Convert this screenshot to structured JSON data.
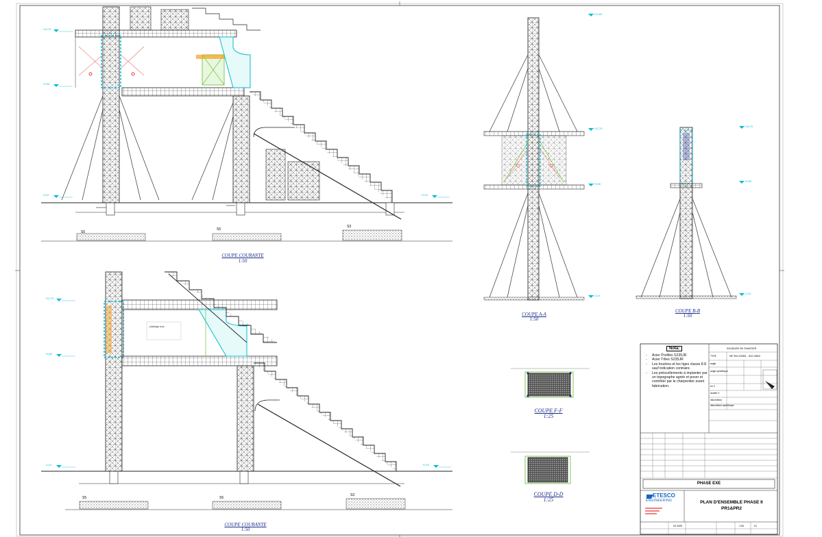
{
  "drawing": {
    "views": {
      "coupe_courante_top": {
        "title": "COUPE COURANTE",
        "scale": "1:50"
      },
      "coupe_courante_bottom": {
        "title": "COUPE COURANTE",
        "scale": "1:50"
      },
      "coupe_a_a": {
        "title": "COUPE A-A",
        "scale": "1:50"
      },
      "coupe_b_b": {
        "title": "COUPE B-B",
        "scale": "1:50"
      },
      "coupe_f_f": {
        "title": "COUPE F-F",
        "scale": "1:25"
      },
      "coupe_d_d": {
        "title": "COUPE D-D",
        "scale": "1:25"
      }
    },
    "foundation_labels": [
      "S5",
      "S5",
      "S3",
      "S5",
      "S5",
      "S3"
    ],
    "level_markers": [
      "+12,70",
      "+9,50",
      "-0,10",
      "+0,10",
      "+12,70",
      "+9,50",
      "-0,10",
      "+0,10",
      "+13,60",
      "+12,70",
      "+9,50",
      "-0,10",
      "+12,70",
      "+9,50",
      "-0,10"
    ]
  },
  "notes": {
    "heading": "Nota:",
    "items": [
      "Acier Profilés S235JR",
      "Acier Tôles S235JR",
      "Les boulons et les tiges classe 8.8 sauf indication contraire.",
      "Les préscellements à implanter par un topographe agréé et poser et contrôler par le charpentier avant fabrication."
    ]
  },
  "weld_table": {
    "title": "SOUDURE DE CHANTIER",
    "norm": "NF EN 22553 - ISO 2553",
    "rows": [
      "TYPE",
      "angle",
      "angle symétrique",
      "en V",
      "double V",
      "discontinus",
      "discontinus symétrique"
    ]
  },
  "title_block": {
    "phase": "PHASE EXE",
    "company_line1": "ETESCO",
    "company_line2": "ENGINEERING",
    "drawing_title_line1": "PLAN D'ENSEMBLE PHASE II",
    "drawing_title_line2": "PR1&PR2",
    "date": "03 2025",
    "scale": "1:50",
    "sheet": "01"
  },
  "colors": {
    "line": "#1a1a1a",
    "cyan": "#00bcd4",
    "orange": "#f5a623",
    "green": "#7ec850",
    "red": "#e53935",
    "blue_title": "#1a2a8c",
    "logo_blue": "#1565c0"
  }
}
